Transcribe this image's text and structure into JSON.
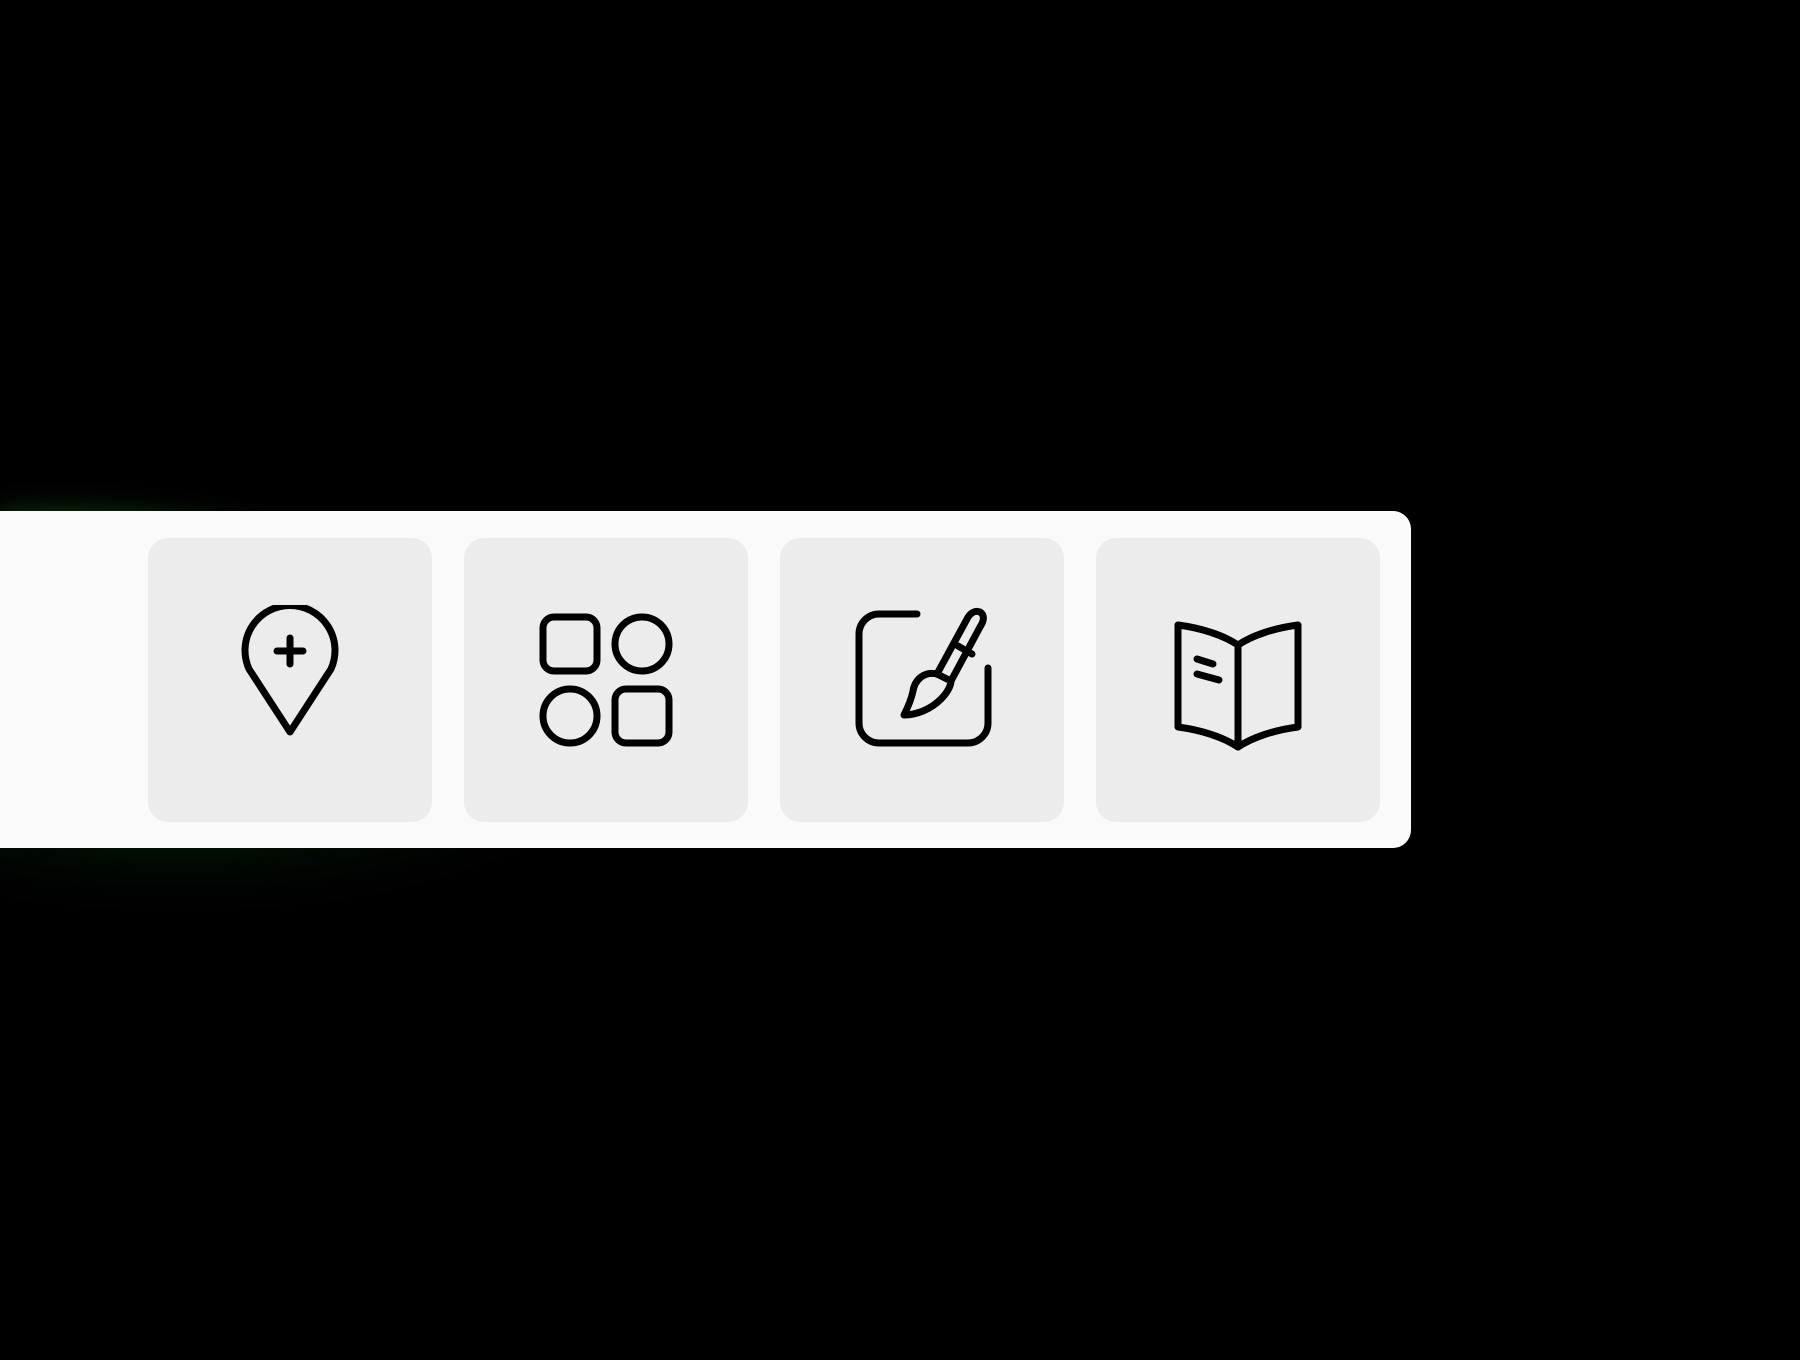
{
  "background_color": "#000000",
  "glow_color": "#2bbf36",
  "dock": {
    "background_color": "#fafafa",
    "tile_color": "#ececec",
    "icon_color": "#000000",
    "items": [
      {
        "icon": "map-pin-plus-icon"
      },
      {
        "icon": "apps-grid-icon"
      },
      {
        "icon": "paint-brush-canvas-icon"
      },
      {
        "icon": "open-book-icon"
      }
    ]
  }
}
